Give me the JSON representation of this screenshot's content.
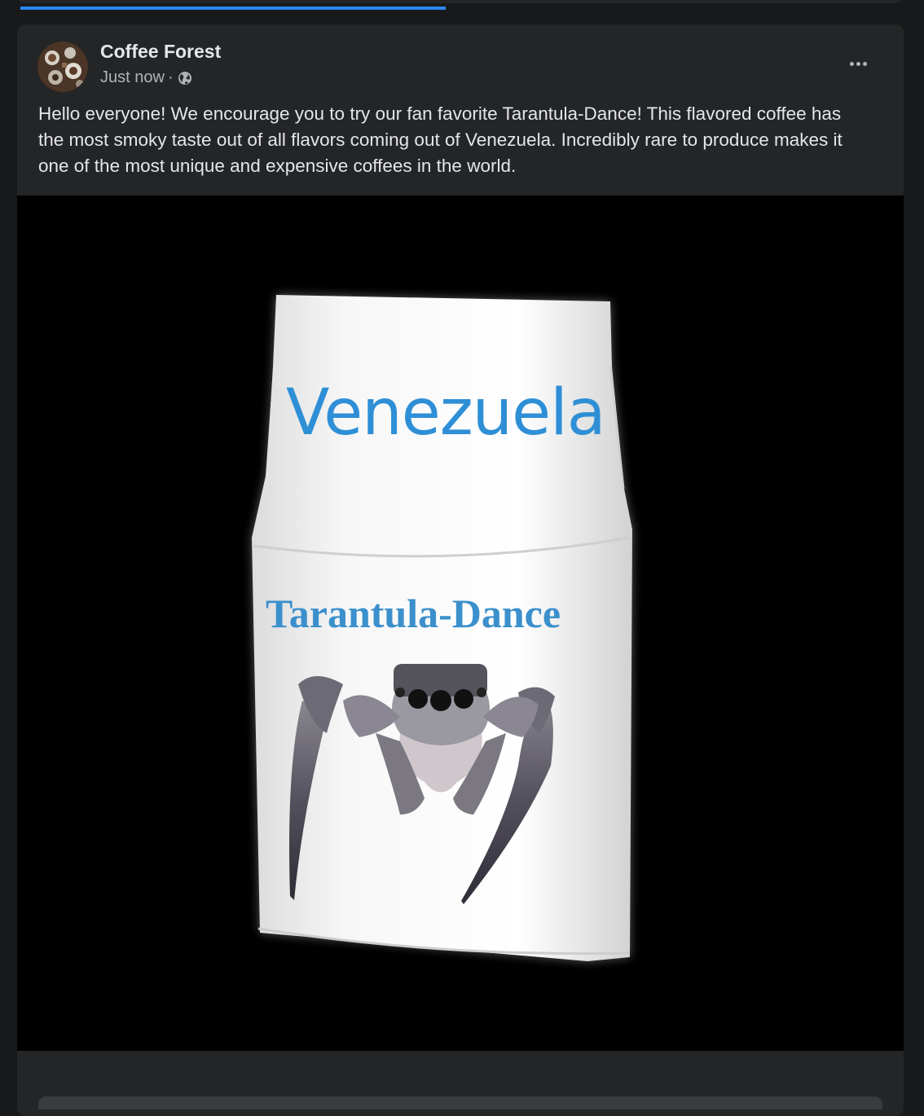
{
  "post": {
    "page_name": "Coffee Forest",
    "time": "Just now",
    "separator": "·",
    "privacy_icon": "globe-icon",
    "more_icon": "more-options-icon",
    "text": "Hello everyone! We encourage you to try our fan favorite Tarantula-Dance! This flavored coffee has the most smoky taste out of all flavors coming out of Venezuela. Incredibly rare to produce makes it one of the most unique and expensive coffees in the world.",
    "image": {
      "bag_text_1": "Venezuela",
      "bag_text_2": "Tarantula-Dance"
    }
  },
  "progress": {
    "fraction": 0.48,
    "color": "#2d88ff"
  },
  "colors": {
    "background": "#18191a",
    "card": "#242526",
    "primary_text": "#e4e6eb",
    "secondary_text": "#b0b3b8"
  }
}
